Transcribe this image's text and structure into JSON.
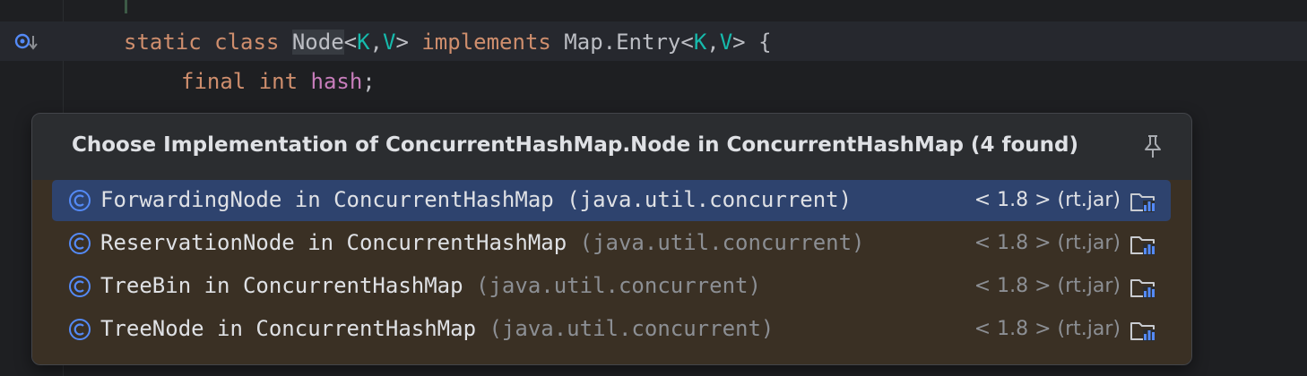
{
  "editor": {
    "line1": {
      "kw1": "static class ",
      "name": "Node",
      "lt": "<",
      "k": "K",
      "comma": ",",
      "v": "V",
      "gt": "> ",
      "kw2": "implements",
      "rest1": " Map.Entry<",
      "k2": "K",
      "comma2": ",",
      "v2": "V",
      "rest2": "> {"
    },
    "line2": {
      "kw": "final int ",
      "field": "hash",
      "semi": ";"
    },
    "gutter_icon": "implemented-override-icon"
  },
  "popup": {
    "title": "Choose Implementation of ConcurrentHashMap.Node in ConcurrentHashMap (4 found)",
    "pin_icon": "pin-icon",
    "items": [
      {
        "name": "ForwardingNode in ConcurrentHashMap",
        "package": "(java.util.concurrent)",
        "library": "< 1.8 > (rt.jar)",
        "selected": true
      },
      {
        "name": "ReservationNode in ConcurrentHashMap",
        "package": "(java.util.concurrent)",
        "library": "< 1.8 > (rt.jar)",
        "selected": false
      },
      {
        "name": "TreeBin in ConcurrentHashMap",
        "package": "(java.util.concurrent)",
        "library": "< 1.8 > (rt.jar)",
        "selected": false
      },
      {
        "name": "TreeNode in ConcurrentHashMap",
        "package": "(java.util.concurrent)",
        "library": "< 1.8 > (rt.jar)",
        "selected": false
      }
    ]
  },
  "colors": {
    "accent_selected": "#2e436e",
    "class_icon": "#548af7",
    "keyword": "#cf8e6d",
    "type_param": "#16baac",
    "field": "#c77dbb"
  }
}
